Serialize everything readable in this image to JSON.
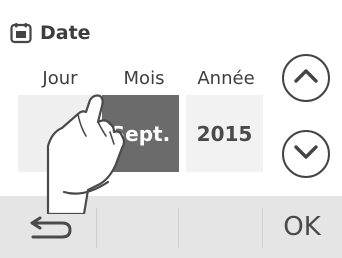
{
  "header": {
    "title": "Date",
    "icon": "calendar-icon"
  },
  "columns": [
    {
      "label": "Jour",
      "value": ""
    },
    {
      "label": "Mois",
      "value": "Sept."
    },
    {
      "label": "Année",
      "value": "2015"
    }
  ],
  "selected_column": "Mois",
  "buttons": {
    "up_icon": "chevron-up-icon",
    "down_icon": "chevron-down-icon",
    "back_icon": "back-arrow-icon",
    "ok_label": "OK"
  },
  "colors": {
    "selected_cell": "#6b6b6b",
    "cell": "#efefef",
    "bottom_bar": "#e5e5e5"
  }
}
